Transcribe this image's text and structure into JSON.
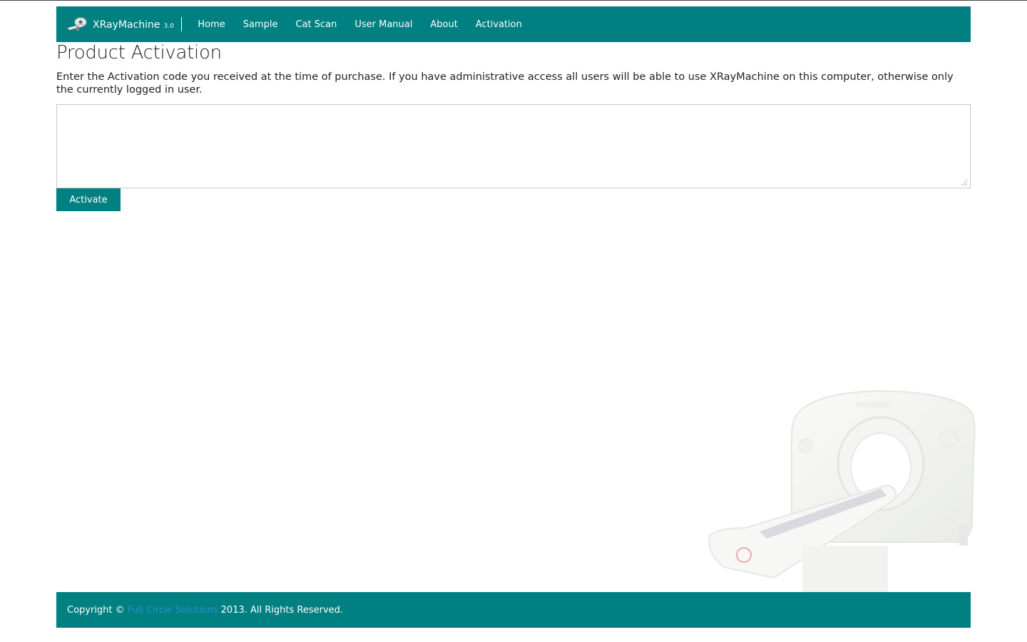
{
  "nav": {
    "brand_name": "XRayMachine",
    "brand_version": "3.0",
    "items": [
      "Home",
      "Sample",
      "Cat Scan",
      "User Manual",
      "About",
      "Activation"
    ]
  },
  "page": {
    "title": "Product Activation",
    "intro": "Enter the Activation code you received at the time of purchase. If you have administrative access all users will be able to use XRayMachine on this computer, otherwise only the currently logged in user.",
    "code_value": "",
    "activate_label": "Activate"
  },
  "footer": {
    "prefix": "Copyright © ",
    "link_text": "Full Circle Solutions",
    "suffix": " 2013. All Rights Reserved."
  },
  "icons": {
    "brand_logo": "xray-machine-icon",
    "resize_grip": "resize-grip-icon",
    "background_art": "ct-scanner-illustration"
  },
  "colors": {
    "accent": "#008080",
    "link": "#2a8fd0",
    "text": "#222222"
  }
}
